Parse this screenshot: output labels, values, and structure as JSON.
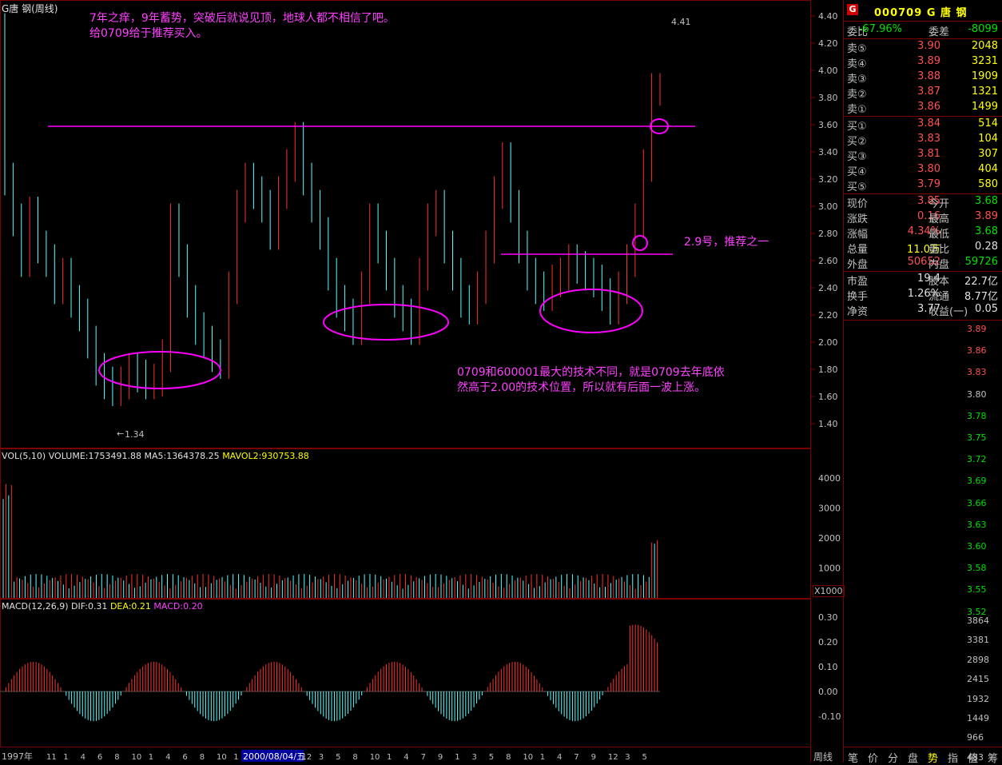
{
  "chart_title": "G唐 钢(周线)",
  "stock": {
    "code": "000709",
    "name": "G 唐  钢",
    "logo": "G"
  },
  "annotations": {
    "top_line1": "7年之痒，9年蓄势，突破后就说见顶，地球人都不相信了吧。",
    "top_line2": "给0709给于推荐买入。",
    "mid_label": "2.9号，推荐之一",
    "bottom_line1": "0709和600001最大的技术不同，就是0709去年底依",
    "bottom_line2": "然高于2.00的技术位置，所以就有后面一波上涨。"
  },
  "price_axis": [
    "4.40",
    "4.20",
    "4.00",
    "3.80",
    "3.60",
    "3.40",
    "3.20",
    "3.00",
    "2.80",
    "2.60",
    "2.40",
    "2.20",
    "2.00",
    "1.80",
    "1.60",
    "1.40"
  ],
  "max_label": "4.41",
  "min_label": "1.34",
  "volume_panel": {
    "label": "VOL(5,10)",
    "volume": "VOLUME:1753491.88",
    "ma5": "MA5:1364378.25",
    "mavol2": "MAVOL2:930753.88",
    "axis": [
      "4000",
      "3000",
      "2000",
      "1000"
    ],
    "unit": "X1000"
  },
  "macd_panel": {
    "label": "MACD(12,26,9)",
    "dif": "DIF:0.31",
    "dea": "DEA:0.21",
    "macd": "MACD:0.20",
    "axis": [
      "0.30",
      "0.20",
      "0.10",
      "0.00",
      "-0.10"
    ]
  },
  "time_axis": {
    "start": "1997年",
    "highlight": "2000/08/04/五",
    "ticks": [
      "11",
      "1",
      "4",
      "6",
      "8",
      "10",
      "1",
      "4",
      "6",
      "8",
      "10",
      "1",
      "4",
      "7",
      "9",
      "12",
      "3",
      "5",
      "8",
      "10",
      "1",
      "4",
      "7",
      "9",
      "1",
      "3",
      "5",
      "8",
      "10",
      "1",
      "4",
      "7",
      "9",
      "12",
      "3",
      "5"
    ],
    "period_btn": "周线"
  },
  "quote": {
    "weibi_label": "委比",
    "weibi": "-67.96%",
    "weicha_label": "委差",
    "weicha": "-8099",
    "sell": [
      {
        "label": "卖⑤",
        "price": "3.90",
        "vol": "2048"
      },
      {
        "label": "卖④",
        "price": "3.89",
        "vol": "3231"
      },
      {
        "label": "卖③",
        "price": "3.88",
        "vol": "1909"
      },
      {
        "label": "卖②",
        "price": "3.87",
        "vol": "1321"
      },
      {
        "label": "卖①",
        "price": "3.86",
        "vol": "1499"
      }
    ],
    "buy": [
      {
        "label": "买①",
        "price": "3.84",
        "vol": "514"
      },
      {
        "label": "买②",
        "price": "3.83",
        "vol": "104"
      },
      {
        "label": "买③",
        "price": "3.81",
        "vol": "307"
      },
      {
        "label": "买④",
        "price": "3.80",
        "vol": "404"
      },
      {
        "label": "买⑤",
        "price": "3.79",
        "vol": "580"
      }
    ],
    "stats": [
      {
        "l1": "现价",
        "v1": "3.85",
        "c1": "red",
        "l2": "今开",
        "v2": "3.68",
        "c2": "grn"
      },
      {
        "l1": "涨跌",
        "v1": "0.16",
        "c1": "red",
        "l2": "最高",
        "v2": "3.89",
        "c2": "red"
      },
      {
        "l1": "涨幅",
        "v1": "4.34%",
        "c1": "red",
        "l2": "最低",
        "v2": "3.68",
        "c2": "grn"
      },
      {
        "l1": "总量",
        "v1": "11.0万",
        "c1": "yel",
        "l2": "量比",
        "v2": "0.28",
        "c2": "wht"
      },
      {
        "l1": "外盘",
        "v1": "50652",
        "c1": "red",
        "l2": "内盘",
        "v2": "59726",
        "c2": "grn"
      }
    ],
    "fin": [
      {
        "l1": "市盈",
        "v1": "19.4",
        "l2": "股本",
        "v2": "22.7亿"
      },
      {
        "l1": "换手",
        "v1": "1.26%",
        "l2": "流通",
        "v2": "8.77亿"
      },
      {
        "l1": "净资",
        "v1": "3.77",
        "l2": "收益(一)",
        "v2": "0.05"
      }
    ]
  },
  "intraday_axis": [
    "3.89",
    "3.86",
    "3.83",
    "3.80",
    "3.78",
    "3.75",
    "3.72",
    "3.69",
    "3.66",
    "3.63",
    "3.60",
    "3.58",
    "3.55",
    "3.52"
  ],
  "intraday_vol_axis": [
    "3864",
    "3381",
    "2898",
    "2415",
    "1932",
    "1449",
    "966",
    "483"
  ],
  "tabs": [
    "笔",
    "价",
    "分",
    "盘",
    "势",
    "指",
    "值",
    "筹"
  ],
  "active_tab": "势"
}
